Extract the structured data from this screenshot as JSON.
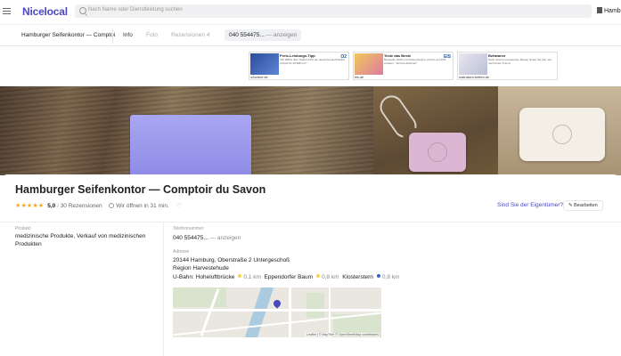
{
  "header": {
    "logo": "Nicelocal",
    "search_placeholder": "Nach Name oder Dienstleistung suchen",
    "city": "Hamb"
  },
  "subnav": {
    "business_name": "Hamburger Seifenkontor — Comptoi",
    "tabs": [
      "Info",
      "Foto",
      "Rezensionen",
      "4"
    ],
    "phone_prefix": "040 554475...",
    "phone_more": "— anzeigen"
  },
  "ads": [
    {
      "title": "Preis-Leistungs-Tipp",
      "text": "750 MBit/s über Telefon-Port der deutsche Fachhandel schnell für 30,99€ mtl.*",
      "domain": "o2online.de",
      "badge": "O2"
    },
    {
      "title": "Teste das Beste",
      "text": "Bestseller 2025 und Online-Partner mit Ihre auf 20% erhalten - Service-Aktionen!",
      "domain": "els.de",
      "badge": "EIS"
    },
    {
      "title": "Bettwaren",
      "text": "Dank unseren preiswerten Besten finden Sie hier, auf nach Ihrem Traum!",
      "domain": "matratzen-betten.de",
      "badge": ""
    }
  ],
  "business": {
    "title": "Hamburger Seifenkontor — Comptoir du Savon",
    "stars": "★★★★★",
    "rating": "5,0",
    "reviews": "30 Rezensionen",
    "hours": "Wir öffnen in 31 min.",
    "owner_link": "Sind Sie der Eigentümer?",
    "edit_button": "Bearbeiten"
  },
  "details": {
    "category_label": "Produkt",
    "category_value": "medizinische Produkte, Verkauf von medizinischen Produkten",
    "phone_label": "Telefonnummer",
    "phone_value": "040 554475...",
    "phone_more": "— anzeigen",
    "address_label": "Adresse",
    "address_line1": "20144 Hamburg, Oberstraße 2 Untergeschoß",
    "address_line2": "Region Harvestehude",
    "metro": [
      {
        "name": "U-Bahn: Hoheluftbrücke",
        "dist": "0,1 km",
        "color": "#f5d74a"
      },
      {
        "name": "Eppendorfer Baum",
        "dist": "0,8 km",
        "color": "#f5d74a"
      },
      {
        "name": "Klosterstern",
        "dist": "0,8 km",
        "color": "#3a5fcd"
      }
    ],
    "map_attribution": "Leaflet | © MapTiler © OpenStreetMap contributors"
  },
  "colors": {
    "brand": "#4a47c4",
    "star": "#f5a623"
  }
}
